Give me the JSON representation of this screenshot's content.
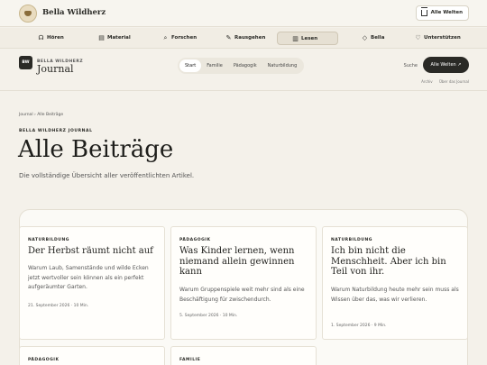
{
  "topbar": {
    "brand": "Bella Wildherz",
    "worlds_button": "Alle Welten"
  },
  "nav": [
    {
      "label": "Hören",
      "icon": "headphones-icon",
      "glyph": "☊"
    },
    {
      "label": "Material",
      "icon": "document-icon",
      "glyph": "▤"
    },
    {
      "label": "Forschen",
      "icon": "magnifier-icon",
      "glyph": "⌕"
    },
    {
      "label": "Rausgehen",
      "icon": "leaf-icon",
      "glyph": "✎"
    },
    {
      "label": "Lesen",
      "icon": "book-icon",
      "glyph": "▥"
    },
    {
      "label": "Bella",
      "icon": "shield-icon",
      "glyph": "◇"
    },
    {
      "label": "Unterstützen",
      "icon": "heart-icon",
      "glyph": "♡"
    }
  ],
  "journal": {
    "badge": "BW",
    "brand_small": "BELLA WILDHERZ",
    "brand_big": "Journal",
    "tabs": [
      "Start",
      "Familie",
      "Pädagogik",
      "Naturbildung"
    ],
    "search": "Suche",
    "worlds": "Alle Welten ↗",
    "sublinks": [
      "Archiv",
      "Über das Journal"
    ]
  },
  "page": {
    "breadcrumb": "Journal › Alle Beiträge",
    "kicker": "BELLA WILDHERZ JOURNAL",
    "title": "Alle Beiträge",
    "subtitle": "Die vollständige Übersicht aller veröffentlichten Artikel."
  },
  "cards": [
    {
      "category": "NATURBILDUNG",
      "title": "Der Herbst räumt nicht auf",
      "excerpt": "Warum Laub, Samenstände und wilde Ecken jetzt wertvoller sein können als ein perfekt aufgeräumter Garten.",
      "meta": "21. September 2026 · 10 Min."
    },
    {
      "category": "PÄDAGOGIK",
      "title": "Was Kinder lernen, wenn niemand allein gewinnen kann",
      "excerpt": "Warum Gruppenspiele weit mehr sind als eine Beschäftigung für zwischendurch.",
      "meta": "5. September 2026 · 10 Min."
    },
    {
      "category": "NATURBILDUNG",
      "title": "Ich bin nicht die Menschheit. Aber ich bin Teil von ihr.",
      "excerpt": "Warum Naturbildung heute mehr sein muss als Wissen über das, was wir verlieren.",
      "meta": "1. September 2026 · 9 Min."
    },
    {
      "category": "PÄDAGOGIK",
      "title": "",
      "excerpt": "",
      "meta": ""
    },
    {
      "category": "FAMILIE",
      "title": "",
      "excerpt": "",
      "meta": ""
    }
  ]
}
